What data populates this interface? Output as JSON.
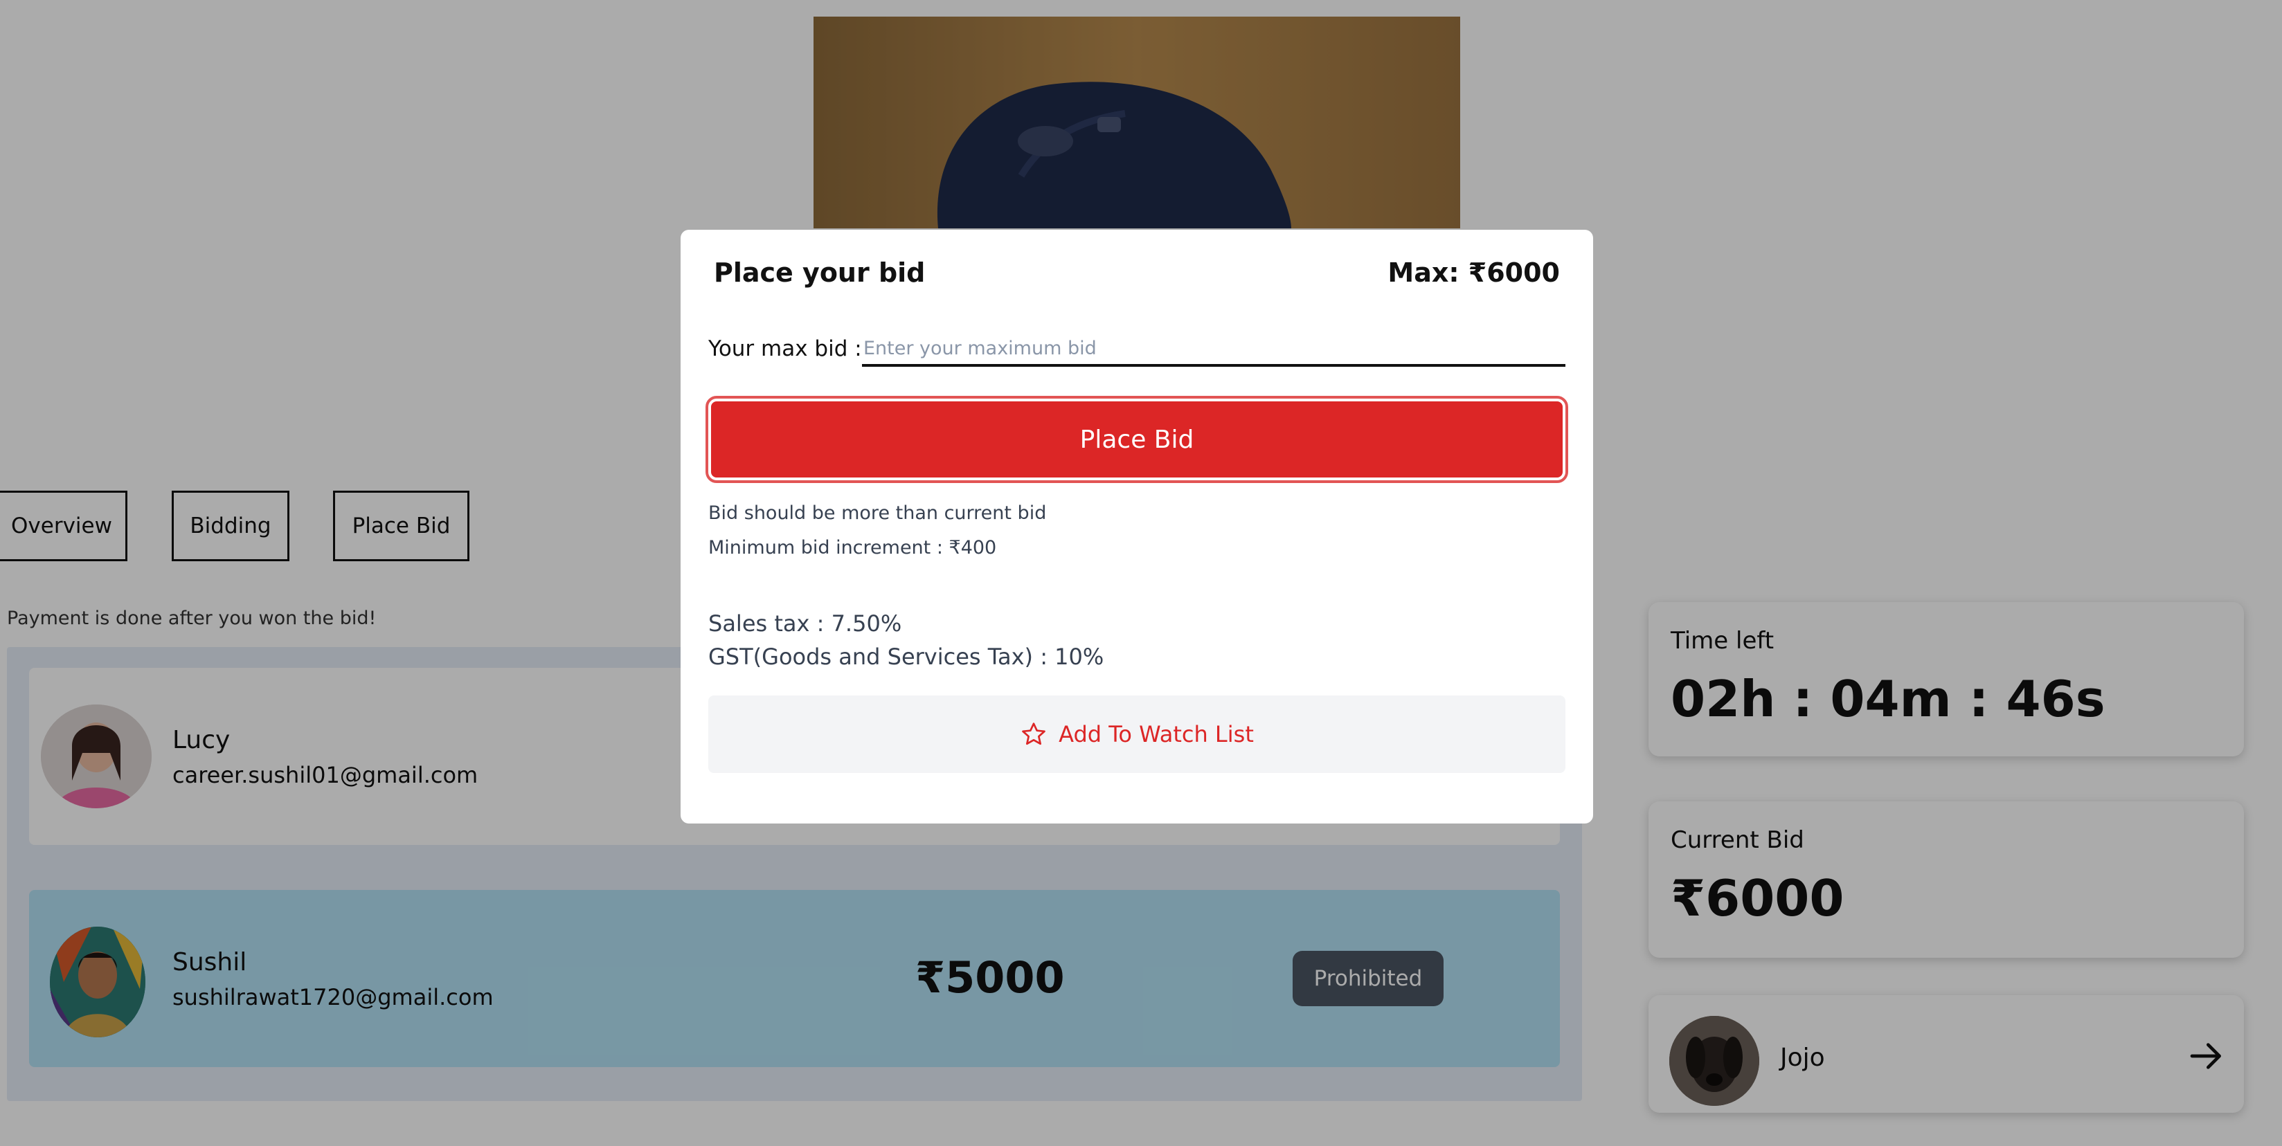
{
  "tabs": [
    "Overview",
    "Bidding",
    "Place Bid"
  ],
  "payment_note": "Payment is done after you won the bid!",
  "bidders": [
    {
      "name": "Lucy",
      "email": "career.sushil01@gmail.com"
    },
    {
      "name": "Sushil",
      "email": "sushilrawat1720@gmail.com",
      "amount": "₹5000",
      "status": "Prohibited"
    }
  ],
  "time_left": {
    "label": "Time left",
    "value": "02h : 04m : 46s"
  },
  "current_bid": {
    "label": "Current Bid",
    "value": "₹6000"
  },
  "seller": {
    "name": "Jojo"
  },
  "modal": {
    "title": "Place your bid",
    "max": "Max: ₹6000",
    "max_bid_label": "Your max bid :",
    "max_bid_placeholder": "Enter your maximum bid",
    "place_bid_label": "Place Bid",
    "hint_1": "Bid should be more than current bid",
    "hint_2": "Minimum bid increment : ₹400",
    "sales_tax": "Sales tax : 7.50%",
    "gst": "GST(Goods and Services Tax) : 10%",
    "watch_label": "Add To Watch List"
  },
  "colors": {
    "accent": "#dc2626",
    "badge": "#4b5563",
    "highlight_row": "#b3e2f5"
  },
  "icons": {
    "watch": "star-icon",
    "seller_link": "arrow-right-icon"
  }
}
